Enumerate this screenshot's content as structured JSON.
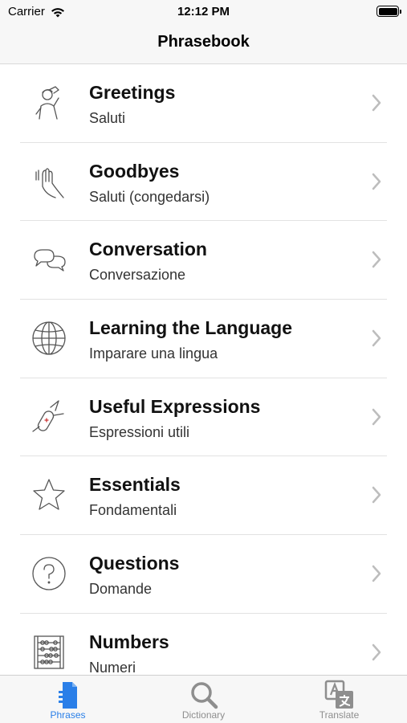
{
  "status_bar": {
    "carrier": "Carrier",
    "time": "12:12 PM"
  },
  "nav": {
    "title": "Phrasebook"
  },
  "rows": [
    {
      "title": "Greetings",
      "subtitle": "Saluti",
      "icon": "person-waving-icon"
    },
    {
      "title": "Goodbyes",
      "subtitle": "Saluti (congedarsi)",
      "icon": "hand-wave-icon"
    },
    {
      "title": "Conversation",
      "subtitle": "Conversazione",
      "icon": "speech-bubbles-icon"
    },
    {
      "title": "Learning the Language",
      "subtitle": "Imparare una lingua",
      "icon": "globe-icon"
    },
    {
      "title": "Useful Expressions",
      "subtitle": "Espressioni utili",
      "icon": "swiss-knife-icon"
    },
    {
      "title": "Essentials",
      "subtitle": "Fondamentali",
      "icon": "star-icon"
    },
    {
      "title": "Questions",
      "subtitle": "Domande",
      "icon": "question-circle-icon"
    },
    {
      "title": "Numbers",
      "subtitle": "Numeri",
      "icon": "abacus-icon"
    }
  ],
  "tabs": [
    {
      "label": "Phrases",
      "icon": "phrasebook-icon",
      "active": true
    },
    {
      "label": "Dictionary",
      "icon": "search-icon",
      "active": false
    },
    {
      "label": "Translate",
      "icon": "translate-icon",
      "active": false
    }
  ],
  "colors": {
    "accent": "#2a7fe8",
    "inactive_tab": "#8e8e8e",
    "chevron": "#bdbdbd",
    "icon_stroke": "#555555"
  }
}
